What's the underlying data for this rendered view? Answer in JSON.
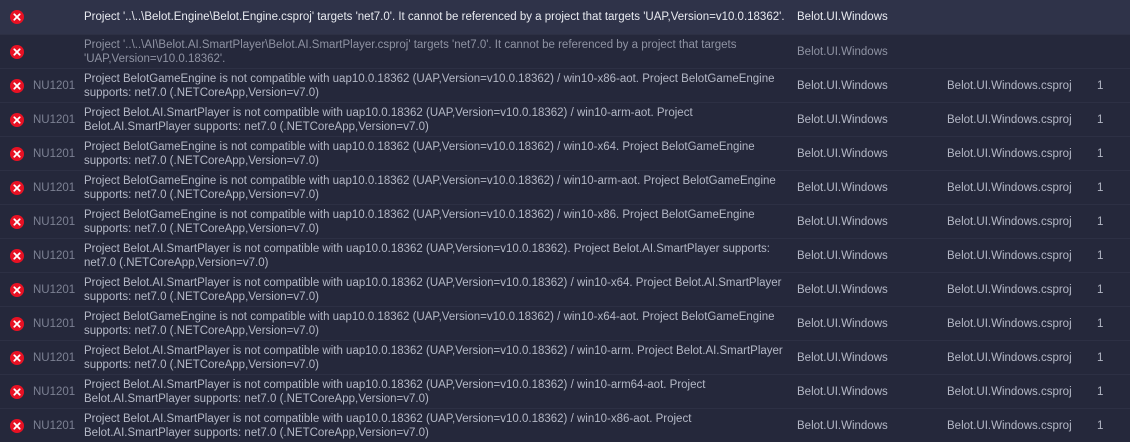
{
  "error_list": {
    "colors": {
      "error_icon": "#e81123",
      "background": "#25283b",
      "selected_row": "#2f3349"
    },
    "rows": [
      {
        "icon": "error-icon",
        "code": "",
        "description": "Project '..\\..\\Belot.Engine\\Belot.Engine.csproj' targets 'net7.0'. It cannot be referenced by a project that targets 'UAP,Version=v10.0.18362'.",
        "project": "Belot.UI.Windows",
        "file": "",
        "line": ""
      },
      {
        "icon": "error-icon",
        "code": "",
        "description": "Project '..\\..\\AI\\Belot.AI.SmartPlayer\\Belot.AI.SmartPlayer.csproj' targets 'net7.0'. It cannot be referenced by a project that targets 'UAP,Version=v10.0.18362'.",
        "project": "Belot.UI.Windows",
        "file": "",
        "line": ""
      },
      {
        "icon": "error-icon",
        "code": "NU1201",
        "description": "Project BelotGameEngine is not compatible with uap10.0.18362 (UAP,Version=v10.0.18362) / win10-x86-aot. Project BelotGameEngine supports: net7.0 (.NETCoreApp,Version=v7.0)",
        "project": "Belot.UI.Windows",
        "file": "Belot.UI.Windows.csproj",
        "line": "1"
      },
      {
        "icon": "error-icon",
        "code": "NU1201",
        "description": "Project Belot.AI.SmartPlayer is not compatible with uap10.0.18362 (UAP,Version=v10.0.18362) / win10-arm-aot. Project Belot.AI.SmartPlayer supports: net7.0 (.NETCoreApp,Version=v7.0)",
        "project": "Belot.UI.Windows",
        "file": "Belot.UI.Windows.csproj",
        "line": "1"
      },
      {
        "icon": "error-icon",
        "code": "NU1201",
        "description": "Project BelotGameEngine is not compatible with uap10.0.18362 (UAP,Version=v10.0.18362) / win10-x64. Project BelotGameEngine supports: net7.0 (.NETCoreApp,Version=v7.0)",
        "project": "Belot.UI.Windows",
        "file": "Belot.UI.Windows.csproj",
        "line": "1"
      },
      {
        "icon": "error-icon",
        "code": "NU1201",
        "description": "Project BelotGameEngine is not compatible with uap10.0.18362 (UAP,Version=v10.0.18362) / win10-arm-aot. Project BelotGameEngine supports: net7.0 (.NETCoreApp,Version=v7.0)",
        "project": "Belot.UI.Windows",
        "file": "Belot.UI.Windows.csproj",
        "line": "1"
      },
      {
        "icon": "error-icon",
        "code": "NU1201",
        "description": "Project BelotGameEngine is not compatible with uap10.0.18362 (UAP,Version=v10.0.18362) / win10-x86. Project BelotGameEngine supports: net7.0 (.NETCoreApp,Version=v7.0)",
        "project": "Belot.UI.Windows",
        "file": "Belot.UI.Windows.csproj",
        "line": "1"
      },
      {
        "icon": "error-icon",
        "code": "NU1201",
        "description": "Project Belot.AI.SmartPlayer is not compatible with uap10.0.18362 (UAP,Version=v10.0.18362). Project Belot.AI.SmartPlayer supports: net7.0 (.NETCoreApp,Version=v7.0)",
        "project": "Belot.UI.Windows",
        "file": "Belot.UI.Windows.csproj",
        "line": "1"
      },
      {
        "icon": "error-icon",
        "code": "NU1201",
        "description": "Project Belot.AI.SmartPlayer is not compatible with uap10.0.18362 (UAP,Version=v10.0.18362) / win10-x64. Project Belot.AI.SmartPlayer supports: net7.0 (.NETCoreApp,Version=v7.0)",
        "project": "Belot.UI.Windows",
        "file": "Belot.UI.Windows.csproj",
        "line": "1"
      },
      {
        "icon": "error-icon",
        "code": "NU1201",
        "description": "Project BelotGameEngine is not compatible with uap10.0.18362 (UAP,Version=v10.0.18362) / win10-x64-aot. Project BelotGameEngine supports: net7.0 (.NETCoreApp,Version=v7.0)",
        "project": "Belot.UI.Windows",
        "file": "Belot.UI.Windows.csproj",
        "line": "1"
      },
      {
        "icon": "error-icon",
        "code": "NU1201",
        "description": "Project Belot.AI.SmartPlayer is not compatible with uap10.0.18362 (UAP,Version=v10.0.18362) / win10-arm. Project Belot.AI.SmartPlayer supports: net7.0 (.NETCoreApp,Version=v7.0)",
        "project": "Belot.UI.Windows",
        "file": "Belot.UI.Windows.csproj",
        "line": "1"
      },
      {
        "icon": "error-icon",
        "code": "NU1201",
        "description": "Project Belot.AI.SmartPlayer is not compatible with uap10.0.18362 (UAP,Version=v10.0.18362) / win10-arm64-aot. Project Belot.AI.SmartPlayer supports: net7.0 (.NETCoreApp,Version=v7.0)",
        "project": "Belot.UI.Windows",
        "file": "Belot.UI.Windows.csproj",
        "line": "1"
      },
      {
        "icon": "error-icon",
        "code": "NU1201",
        "description": "Project Belot.AI.SmartPlayer is not compatible with uap10.0.18362 (UAP,Version=v10.0.18362) / win10-x86-aot. Project Belot.AI.SmartPlayer supports: net7.0 (.NETCoreApp,Version=v7.0)",
        "project": "Belot.UI.Windows",
        "file": "Belot.UI.Windows.csproj",
        "line": "1"
      }
    ]
  }
}
